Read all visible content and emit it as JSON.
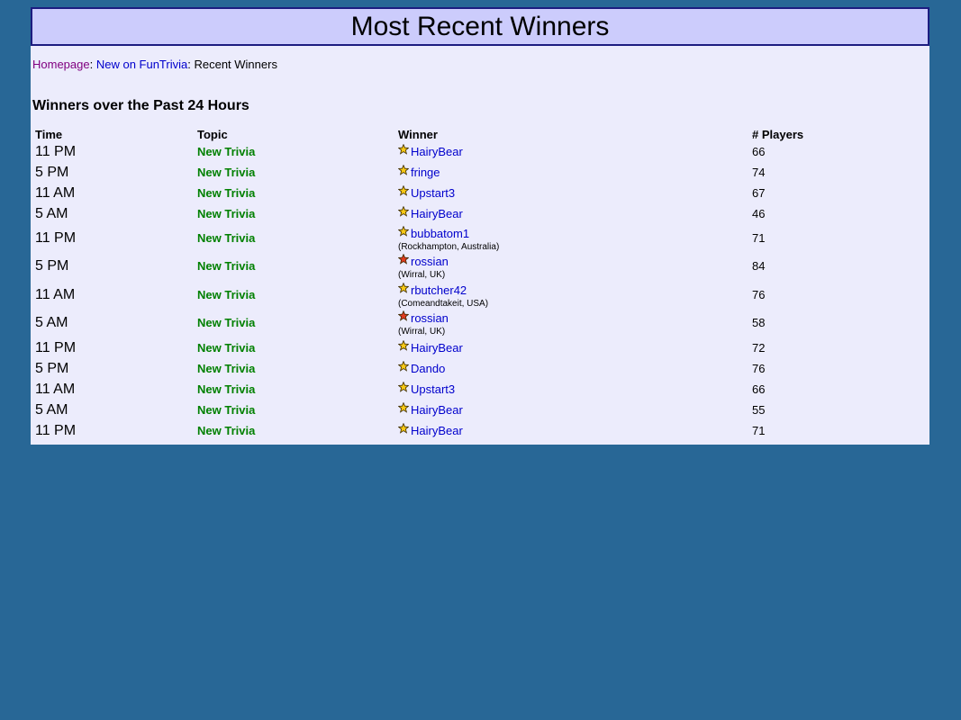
{
  "header": {
    "title": "Most Recent Winners"
  },
  "breadcrumb": {
    "home": "Homepage",
    "sep1": ": ",
    "new": "New on FunTrivia",
    "sep2": ": ",
    "current": "Recent Winners"
  },
  "section_title": "Winners over the Past 24 Hours",
  "columns": {
    "time": "Time",
    "topic": "Topic",
    "winner": "Winner",
    "players": "# Players"
  },
  "rows": [
    {
      "time": "11 PM",
      "topic": "New Trivia",
      "winner": "HairyBear",
      "location": "",
      "star": "gold-star-icon",
      "players": "66"
    },
    {
      "time": "5 PM",
      "topic": "New Trivia",
      "winner": "fringe",
      "location": "",
      "star": "gold-star-icon",
      "players": "74"
    },
    {
      "time": "11 AM",
      "topic": "New Trivia",
      "winner": "Upstart3",
      "location": "",
      "star": "gold-star-icon",
      "players": "67"
    },
    {
      "time": "5 AM",
      "topic": "New Trivia",
      "winner": "HairyBear",
      "location": "",
      "star": "gold-star-icon",
      "players": "46"
    },
    {
      "time": "11 PM",
      "topic": "New Trivia",
      "winner": "bubbatom1",
      "location": "(Rockhampton, Australia)",
      "star": "gold-star-icon",
      "players": "71"
    },
    {
      "time": "5 PM",
      "topic": "New Trivia",
      "winner": "rossian",
      "location": "(Wirral, UK)",
      "star": "red-star-icon",
      "players": "84"
    },
    {
      "time": "11 AM",
      "topic": "New Trivia",
      "winner": "rbutcher42",
      "location": "(Comeandtakeit, USA)",
      "star": "gold-star-icon",
      "players": "76"
    },
    {
      "time": "5 AM",
      "topic": "New Trivia",
      "winner": "rossian",
      "location": "(Wirral, UK)",
      "star": "red-star-icon",
      "players": "58"
    },
    {
      "time": "11 PM",
      "topic": "New Trivia",
      "winner": "HairyBear",
      "location": "",
      "star": "gold-star-icon",
      "players": "72"
    },
    {
      "time": "5 PM",
      "topic": "New Trivia",
      "winner": "Dando",
      "location": "",
      "star": "gold-star-icon",
      "players": "76"
    },
    {
      "time": "11 AM",
      "topic": "New Trivia",
      "winner": "Upstart3",
      "location": "",
      "star": "gold-star-icon",
      "players": "66"
    },
    {
      "time": "5 AM",
      "topic": "New Trivia",
      "winner": "HairyBear",
      "location": "",
      "star": "gold-star-icon",
      "players": "55"
    },
    {
      "time": "11 PM",
      "topic": "New Trivia",
      "winner": "HairyBear",
      "location": "",
      "star": "gold-star-icon",
      "players": "71"
    }
  ],
  "colors": {
    "page_background": "#286796",
    "panel_background": "#ececfc",
    "header_background": "#ccccfc",
    "header_border": "#1c1c80",
    "topic_green": "#008000",
    "link_blue": "#0000cc",
    "visited_purple": "#800080",
    "gold_star": "#f7c815",
    "red_star": "#e23a1e"
  }
}
